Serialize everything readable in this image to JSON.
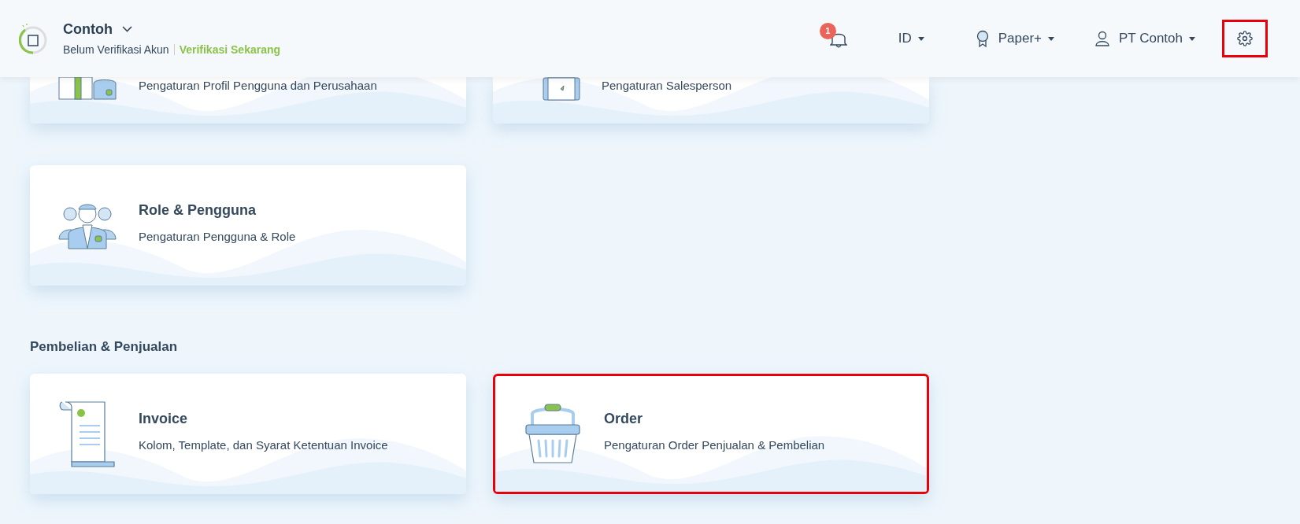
{
  "header": {
    "company": "Contoh",
    "status": "Belum Verifikasi Akun",
    "verify_link": "Verifikasi Sekarang",
    "notification_count": "1",
    "language": "ID",
    "plan": "Paper+",
    "account": "PT Contoh",
    "settings_highlighted": true
  },
  "partial_cards": [
    {
      "kind": "profile",
      "subtitle": "Pengaturan Profil Pengguna dan Perusahaan"
    },
    {
      "kind": "salesperson",
      "subtitle": "Pengaturan Salesperson"
    }
  ],
  "groups": [
    {
      "cards": [
        {
          "kind": "users",
          "title": "Role & Pengguna",
          "subtitle": "Pengaturan Pengguna & Role",
          "highlighted": false
        }
      ]
    },
    {
      "heading": "Pembelian & Penjualan",
      "cards": [
        {
          "kind": "invoice",
          "title": "Invoice",
          "subtitle": "Kolom, Template, dan Syarat Ketentuan Invoice",
          "highlighted": false
        },
        {
          "kind": "basket",
          "title": "Order",
          "subtitle": "Pengaturan Order Penjualan & Pembelian",
          "highlighted": true
        }
      ]
    }
  ]
}
